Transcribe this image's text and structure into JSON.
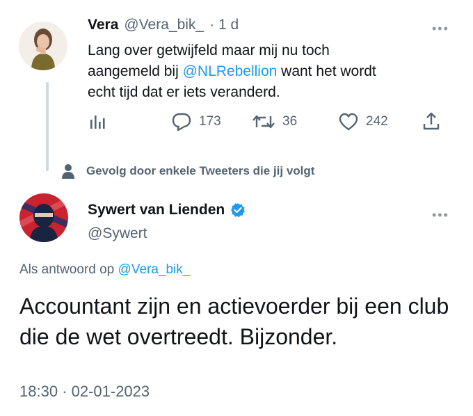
{
  "tweet1": {
    "author_name": "Vera",
    "author_handle": "@Vera_bik_",
    "time_ago": "· 1 d",
    "more_icon": "ellipsis-icon",
    "text_part1": "Lang over getwijfeld maar mij nu toch aangemeld bij ",
    "mention": "@NLRebellion",
    "text_part2": " want het wordt echt tijd dat er iets veranderd.",
    "actions": {
      "analytics_icon": "analytics-icon",
      "replies": "173",
      "retweets": "36",
      "likes": "242",
      "share_icon": "share-icon"
    }
  },
  "social_context": {
    "icon": "person-icon",
    "text": "Gevolg door enkele Tweeters die jij volgt"
  },
  "tweet2": {
    "author_name": "Sywert van Lienden",
    "verified_icon": "verified-badge-icon",
    "author_handle": "@Sywert",
    "more_icon": "ellipsis-icon",
    "reply_prefix": "Als antwoord op ",
    "reply_handle": "@Vera_bik_",
    "text": "Accountant zijn en actievoerder bij een club die de wet overtreedt. Bijzonder.",
    "timestamp": "18:30 · 02-01-2023"
  },
  "colors": {
    "accent": "#1d9bf0",
    "secondary_text": "#536471",
    "primary_text": "#0f1419",
    "thread_line": "#cfd9de"
  }
}
